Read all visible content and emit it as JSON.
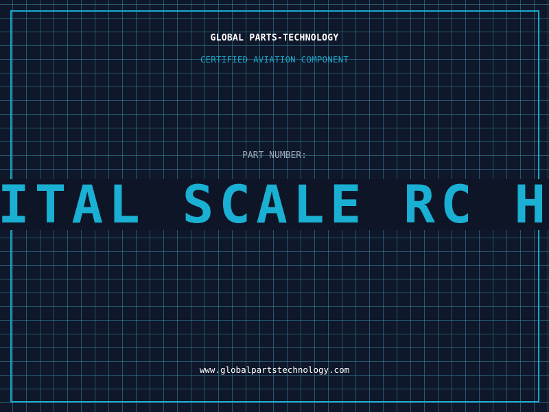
{
  "header": {
    "company_name": "GLOBAL PARTS-TECHNOLOGY",
    "subtitle": "CERTIFIED AVIATION COMPONENT"
  },
  "part": {
    "label": "PART NUMBER:",
    "number": "DIGITAL SCALE RC HELI"
  },
  "footer": {
    "website": "www.globalpartstechnology.com"
  },
  "colors": {
    "background": "#0f172a",
    "accent": "#1aa9cc",
    "grid": "#388ca0",
    "text_primary": "#ffffff",
    "text_muted": "#9aa7b8"
  }
}
